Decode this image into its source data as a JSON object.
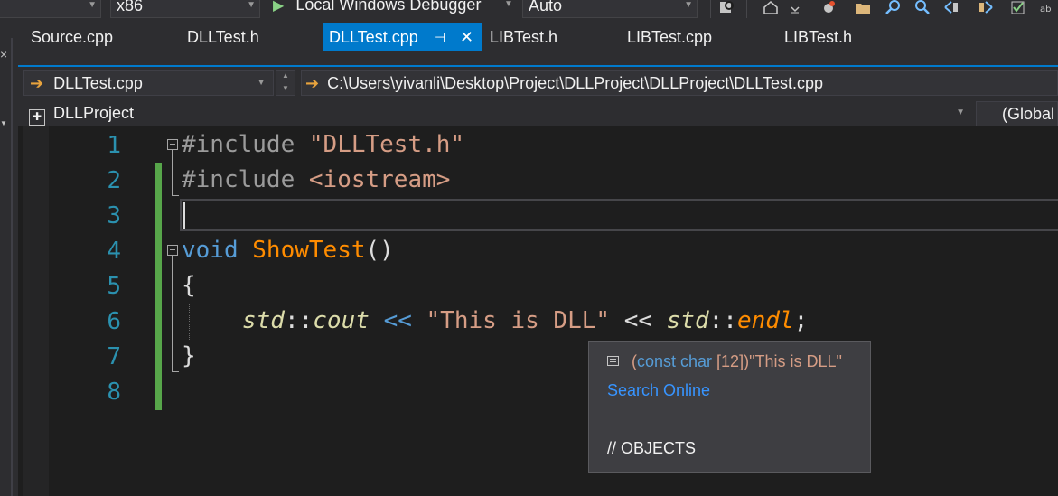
{
  "toolbar": {
    "platform": "x86",
    "debugger_label": "Local Windows Debugger",
    "mode": "Auto"
  },
  "tabs": [
    {
      "label": "Source.cpp",
      "active": false
    },
    {
      "label": "DLLTest.h",
      "active": false
    },
    {
      "label": "DLLTest.cpp",
      "active": true,
      "pin": "⊣",
      "close": "✕"
    },
    {
      "label": "LIBTest.h",
      "active": false
    },
    {
      "label": "LIBTest.cpp",
      "active": false
    },
    {
      "label": "LIBTest.h",
      "active": false
    }
  ],
  "nav": {
    "file": "DLLTest.cpp",
    "path": "C:\\Users\\yivanli\\Desktop\\Project\\DLLProject\\DLLProject\\DLLTest.cpp",
    "project": "DLLProject",
    "scope": "(Global"
  },
  "code": {
    "line_numbers": [
      "1",
      "2",
      "3",
      "4",
      "5",
      "6",
      "7",
      "8"
    ],
    "line1": {
      "pp": "#include",
      "str": "\"DLLTest.h\""
    },
    "line2": {
      "pp": "#include",
      "inc": "<iostream>"
    },
    "line4": {
      "kw": "void",
      "fn": "ShowTest",
      "paren": "()"
    },
    "line5": "{",
    "line6": {
      "ns": "std",
      "sep1": "::",
      "var": "cout",
      "op": "<<",
      "str": "\"This is DLL\"",
      "op2": "<<",
      "ns2": "std",
      "sep2": "::",
      "fn": "endl",
      "semi": ";"
    },
    "line7": "}"
  },
  "tooltip": {
    "type_prefix": "(",
    "type_kw": "const char",
    "type_rest": " [12])",
    "value": "\"This is DLL\"",
    "search_link": "Search Online",
    "comment": "// OBJECTS"
  },
  "colors": {
    "accent": "#007acc",
    "keyword": "#569cd6",
    "string": "#d69d85",
    "function": "#ff8c00",
    "line_number": "#2b91af",
    "change_bar": "#57a64a"
  }
}
